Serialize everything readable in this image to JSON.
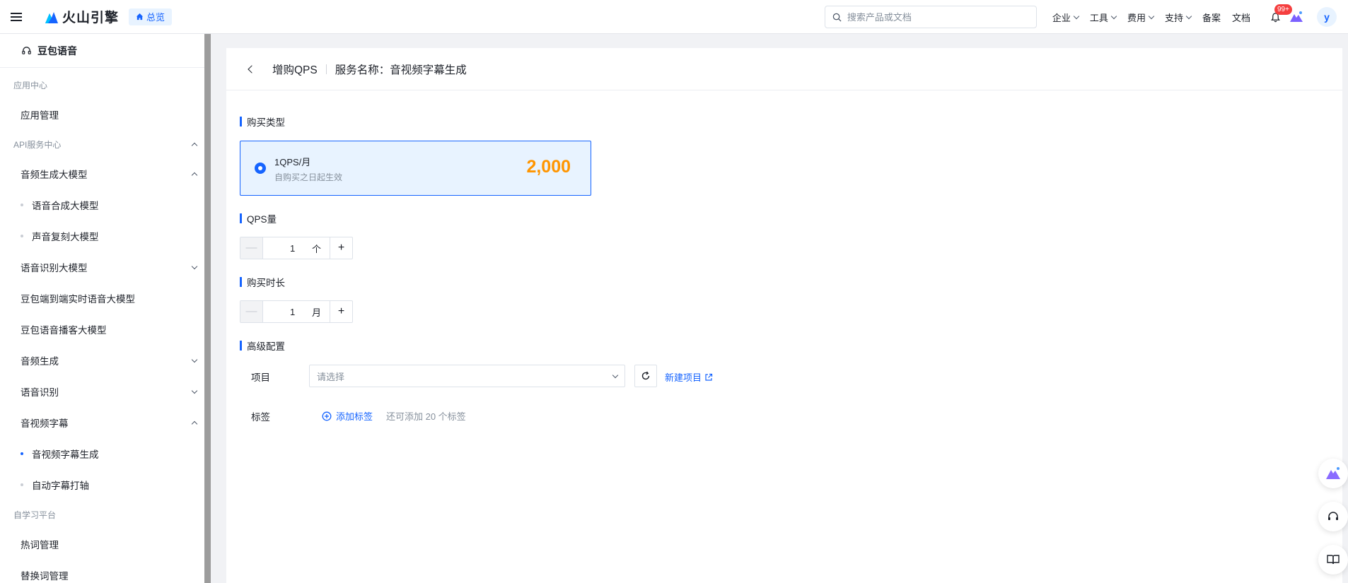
{
  "topbar": {
    "brand": "火山引擎",
    "overview_label": "总览",
    "search_placeholder": "搜索产品或文档",
    "nav": [
      {
        "label": "企业",
        "has_menu": true
      },
      {
        "label": "工具",
        "has_menu": true
      },
      {
        "label": "费用",
        "has_menu": true
      },
      {
        "label": "支持",
        "has_menu": true
      },
      {
        "label": "备案",
        "has_menu": false
      },
      {
        "label": "文档",
        "has_menu": false
      }
    ],
    "notification_badge": "99+",
    "avatar_initial": "y"
  },
  "sidebar": {
    "product": "豆包语音",
    "groups": {
      "app_center": "应用中心",
      "app_manage": "应用管理",
      "api_center": "API服务中心",
      "audio_gen_model": "音频生成大模型",
      "tts_model": "语音合成大模型",
      "voice_clone_model": "声音复刻大模型",
      "asr_model": "语音识别大模型",
      "realtime_model": "豆包端到端实时语音大模型",
      "podcast_model": "豆包语音播客大模型",
      "audio_gen": "音频生成",
      "asr": "语音识别",
      "av_subtitle": "音视频字幕",
      "av_subtitle_gen": "音视频字幕生成",
      "auto_subtitle": "自动字幕打轴",
      "self_learning": "自学习平台",
      "hotword": "热词管理",
      "replace_word": "替换词管理"
    }
  },
  "page": {
    "title": "增购QPS",
    "service_name": "服务名称：音视频字幕生成",
    "purchase_type_title": "购买类型",
    "plan": {
      "name": "1QPS/月",
      "desc": "自购买之日起生效",
      "price": "2,000"
    },
    "qps_title": "QPS量",
    "qps": {
      "value": "1",
      "unit": "个"
    },
    "duration_title": "购买时长",
    "duration": {
      "value": "1",
      "unit": "月"
    },
    "advanced_title": "高级配置",
    "project_label": "项目",
    "project_placeholder": "请选择",
    "new_project": "新建项目",
    "tag_label": "标签",
    "add_tag": "添加标签",
    "tag_hint": "还可添加 20 个标签"
  },
  "colors": {
    "primary": "#1664ff",
    "price": "#ff9500",
    "selected_bg": "#e8f3ff",
    "badge": "#f53f3f"
  }
}
